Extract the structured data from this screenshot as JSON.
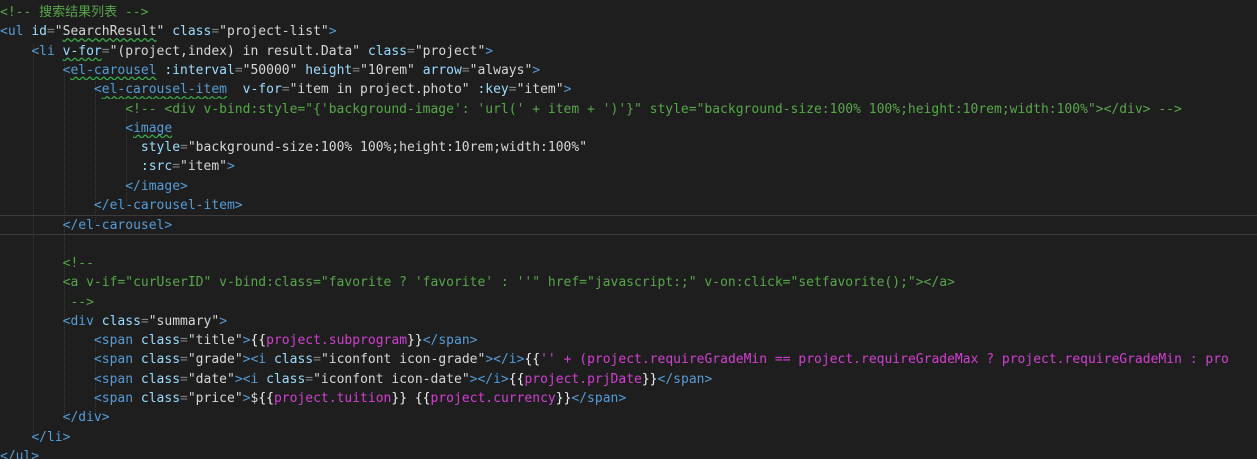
{
  "colors": {
    "background": "#1e1e1e",
    "comment": "#57a64a",
    "tag": "#569cd6",
    "attr": "#9cdcfe",
    "string": "#d6d6d6",
    "text": "#d4d4d4",
    "mustache": "#f0f0f0",
    "binding": "#d040d0",
    "punct": "#808080"
  },
  "editor": {
    "lines": [
      [
        [
          "comment",
          "<!-- 搜索结果列表 -->"
        ]
      ],
      [
        [
          "tag",
          "<ul "
        ],
        [
          "attr",
          "id"
        ],
        [
          "punct",
          "="
        ],
        [
          "string",
          "\""
        ],
        [
          "string",
          "SearchResult",
          "sq"
        ],
        [
          "string",
          "\" "
        ],
        [
          "attr",
          "class"
        ],
        [
          "punct",
          "="
        ],
        [
          "string",
          "\"project-list\""
        ],
        [
          "tag",
          ">"
        ]
      ],
      [
        [
          "text",
          "    "
        ],
        [
          "tag",
          "<li "
        ],
        [
          "attr",
          "v-for",
          "sq"
        ],
        [
          "punct",
          "="
        ],
        [
          "string",
          "\"(project,index) in result.Data\" "
        ],
        [
          "attr",
          "class"
        ],
        [
          "punct",
          "="
        ],
        [
          "string",
          "\"project\""
        ],
        [
          "tag",
          ">"
        ]
      ],
      [
        [
          "text",
          "        "
        ],
        [
          "tag",
          "<"
        ],
        [
          "tag",
          "el-carousel",
          "sq"
        ],
        [
          "tag",
          " "
        ],
        [
          "attr",
          ":interval"
        ],
        [
          "punct",
          "="
        ],
        [
          "string",
          "\"50000\" "
        ],
        [
          "attr",
          "height"
        ],
        [
          "punct",
          "="
        ],
        [
          "string",
          "\"10rem\" "
        ],
        [
          "attr",
          "arrow"
        ],
        [
          "punct",
          "="
        ],
        [
          "string",
          "\"always\""
        ],
        [
          "tag",
          ">"
        ]
      ],
      [
        [
          "text",
          "            "
        ],
        [
          "tag",
          "<"
        ],
        [
          "tag",
          "el-carousel-item",
          "sq"
        ],
        [
          "tag",
          "  "
        ],
        [
          "attr",
          "v-for"
        ],
        [
          "punct",
          "="
        ],
        [
          "string",
          "\"item in project.photo\" "
        ],
        [
          "attr",
          ":key"
        ],
        [
          "punct",
          "="
        ],
        [
          "string",
          "\"item\""
        ],
        [
          "tag",
          ">"
        ]
      ],
      [
        [
          "text",
          "                "
        ],
        [
          "comment",
          "<!-- <div v-bind:style=\"{'background-image': 'url(' + item + ')'}\" style=\"background-size:100% 100%;height:10rem;width:100%\"></div> -->"
        ]
      ],
      [
        [
          "text",
          "                "
        ],
        [
          "tag",
          "<"
        ],
        [
          "tag",
          "image",
          "sq"
        ]
      ],
      [
        [
          "text",
          "                  "
        ],
        [
          "attr",
          "style"
        ],
        [
          "punct",
          "="
        ],
        [
          "string",
          "\"background-size:100% 100%;height:10rem;width:100%\""
        ]
      ],
      [
        [
          "text",
          "                  "
        ],
        [
          "attr",
          ":src"
        ],
        [
          "punct",
          "="
        ],
        [
          "string",
          "\"item\""
        ],
        [
          "tag",
          ">"
        ]
      ],
      [
        [
          "text",
          "                "
        ],
        [
          "tag",
          "</image>"
        ]
      ],
      [
        [
          "text",
          "            "
        ],
        [
          "tag",
          "</el-carousel-item>"
        ]
      ],
      [
        [
          "text",
          "        "
        ],
        [
          "tag",
          "</el-carousel>"
        ]
      ],
      [
        [
          "text",
          ""
        ]
      ],
      [
        [
          "text",
          "        "
        ],
        [
          "comment",
          "<!--"
        ]
      ],
      [
        [
          "text",
          "        "
        ],
        [
          "comment",
          "<a v-if=\"curUserID\" v-bind:class=\"favorite ? 'favorite' : ''\" href=\"javascript:;\" v-on:click=\"setfavorite();\"></a>"
        ]
      ],
      [
        [
          "text",
          "         "
        ],
        [
          "comment",
          "-->"
        ]
      ],
      [
        [
          "text",
          "        "
        ],
        [
          "tag",
          "<div "
        ],
        [
          "attr",
          "class"
        ],
        [
          "punct",
          "="
        ],
        [
          "string",
          "\"summary\""
        ],
        [
          "tag",
          ">"
        ]
      ],
      [
        [
          "text",
          "            "
        ],
        [
          "tag",
          "<span "
        ],
        [
          "attr",
          "class"
        ],
        [
          "punct",
          "="
        ],
        [
          "string",
          "\"title\""
        ],
        [
          "tag",
          ">"
        ],
        [
          "mustache",
          "{{"
        ],
        [
          "binding",
          "project.subprogram"
        ],
        [
          "mustache",
          "}}"
        ],
        [
          "tag",
          "</span>"
        ]
      ],
      [
        [
          "text",
          "            "
        ],
        [
          "tag",
          "<span "
        ],
        [
          "attr",
          "class"
        ],
        [
          "punct",
          "="
        ],
        [
          "string",
          "\"grade\""
        ],
        [
          "tag",
          "><i "
        ],
        [
          "attr",
          "class"
        ],
        [
          "punct",
          "="
        ],
        [
          "string",
          "\"iconfont icon-grade\""
        ],
        [
          "tag",
          "></i>"
        ],
        [
          "mustache",
          "{{"
        ],
        [
          "binding",
          "'' + (project.requireGradeMin == project.requireGradeMax ? project.requireGradeMin : pro"
        ]
      ],
      [
        [
          "text",
          "            "
        ],
        [
          "tag",
          "<span "
        ],
        [
          "attr",
          "class"
        ],
        [
          "punct",
          "="
        ],
        [
          "string",
          "\"date\""
        ],
        [
          "tag",
          "><i "
        ],
        [
          "attr",
          "class"
        ],
        [
          "punct",
          "="
        ],
        [
          "string",
          "\"iconfont icon-date\""
        ],
        [
          "tag",
          "></i>"
        ],
        [
          "mustache",
          "{{"
        ],
        [
          "binding",
          "project.prjDate"
        ],
        [
          "mustache",
          "}}"
        ],
        [
          "tag",
          "</span>"
        ]
      ],
      [
        [
          "text",
          "            "
        ],
        [
          "tag",
          "<span "
        ],
        [
          "attr",
          "class"
        ],
        [
          "punct",
          "="
        ],
        [
          "string",
          "\"price\""
        ],
        [
          "tag",
          ">"
        ],
        [
          "text",
          "$"
        ],
        [
          "mustache",
          "{{"
        ],
        [
          "binding",
          "project.tuition"
        ],
        [
          "mustache",
          "}} {{"
        ],
        [
          "binding",
          "project.currency"
        ],
        [
          "mustache",
          "}}"
        ],
        [
          "tag",
          "</span>"
        ]
      ],
      [
        [
          "text",
          "        "
        ],
        [
          "tag",
          "</div>"
        ]
      ],
      [
        [
          "text",
          "    "
        ],
        [
          "tag",
          "</li>"
        ]
      ],
      [
        [
          "tag",
          "</ul>"
        ]
      ]
    ]
  }
}
